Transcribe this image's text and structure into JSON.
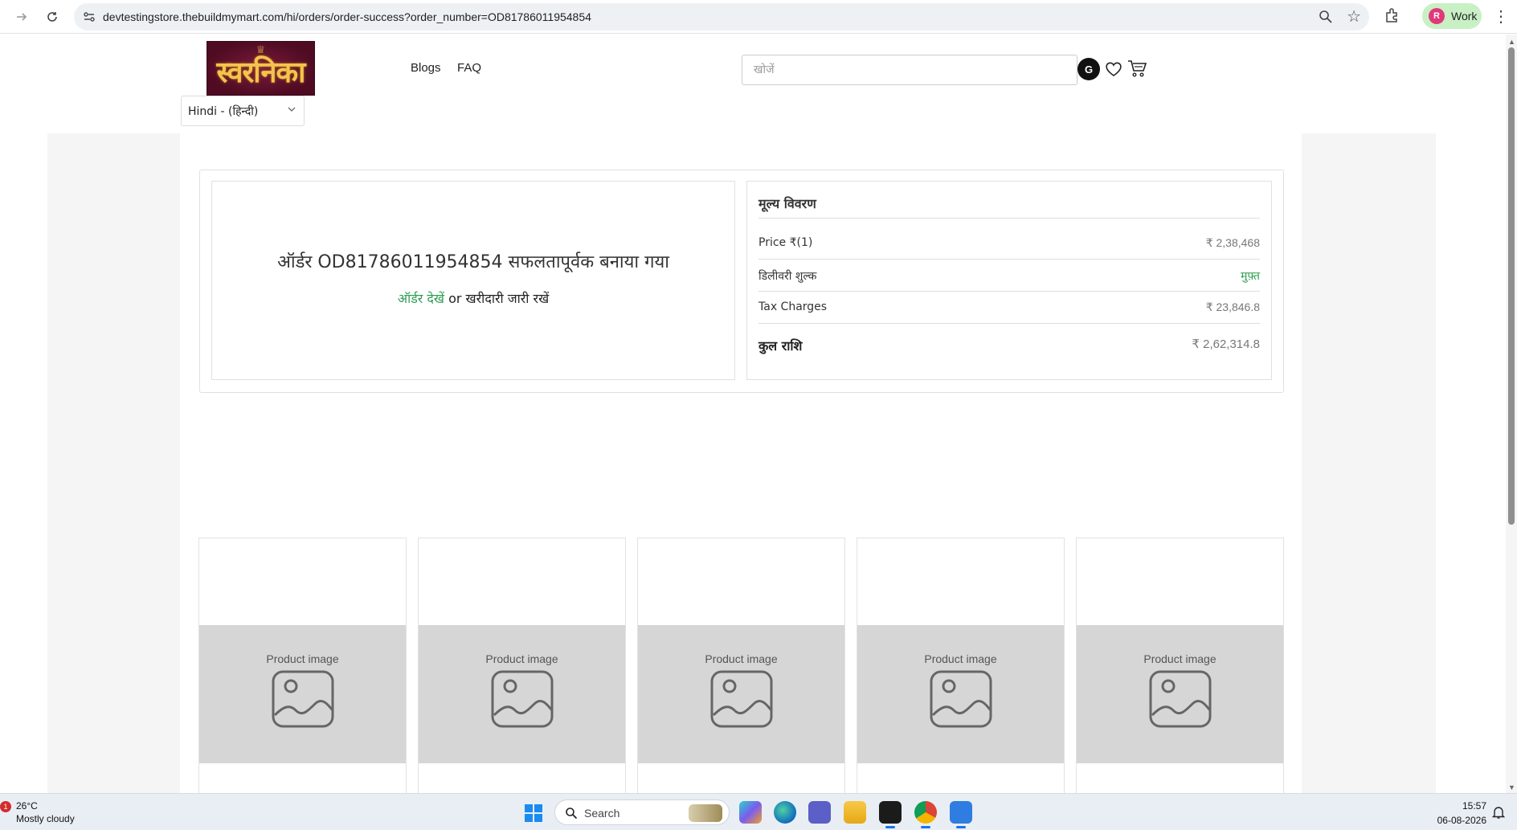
{
  "browser": {
    "url": "devtestingstore.thebuildmymart.com/hi/orders/order-success?order_number=OD81786011954854",
    "profile_initial": "R",
    "profile_name": "Work",
    "icons": [
      "forward-arrow-icon",
      "reload-icon",
      "site-info-icon",
      "zoom-icon",
      "star-icon",
      "extensions-icon",
      "kebab-menu-icon"
    ]
  },
  "header": {
    "logo_text": "स्वरनिका",
    "nav": [
      {
        "label": "Blogs"
      },
      {
        "label": "FAQ"
      }
    ],
    "search_placeholder": "खोजें",
    "user_initial": "G",
    "language": "Hindi - (हिन्दी)",
    "icons": [
      "heart-icon",
      "cart-icon",
      "chevron-down-icon"
    ]
  },
  "order": {
    "title": "ऑर्डर OD81786011954854 सफलतापूर्वक बनाया गया",
    "view_order_link": "ऑर्डर देखें",
    "or_text": "or",
    "continue_link": "खरीदारी जारी रखें"
  },
  "price_details": {
    "heading": "मूल्य विवरण",
    "rows": [
      {
        "label": "Price ₹(1)",
        "value": "₹ 2,38,468"
      },
      {
        "label": "डिलीवरी शुल्क",
        "value": "मुफ़्त"
      },
      {
        "label": "Tax Charges",
        "value": "₹ 23,846.8"
      }
    ],
    "total_label": "कुल राशि",
    "total_value": "₹ 2,62,314.8"
  },
  "products": [
    {
      "placeholder": "Product image"
    },
    {
      "placeholder": "Product image"
    },
    {
      "placeholder": "Product image"
    },
    {
      "placeholder": "Product image"
    },
    {
      "placeholder": "Product image"
    }
  ],
  "taskbar": {
    "weather_badge": "1",
    "temperature": "26°C",
    "condition": "Mostly cloudy",
    "search_label": "Search",
    "time": "15:57",
    "date": "06-08-2026",
    "apps": [
      "copilot-icon",
      "edge-icon",
      "teams-icon",
      "file-explorer-icon",
      "terminal-icon",
      "chrome-icon",
      "notepad-icon"
    ]
  },
  "colors": {
    "accent_green": "#2e9d52",
    "logo_bg": "#5e0f2a",
    "logo_gold": "#f3c44e",
    "page_grey": "#f5f5f5",
    "profile_chip": "#c8f0c4"
  }
}
